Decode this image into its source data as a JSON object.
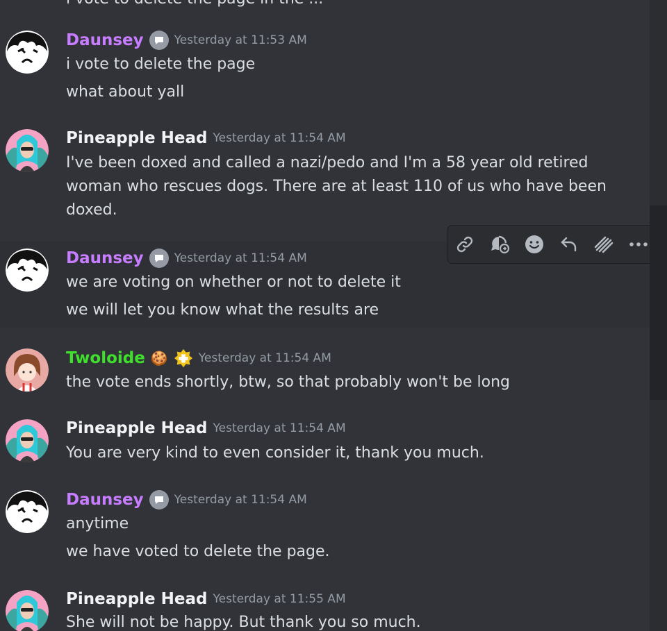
{
  "top_clipped_text": "...the page in the ... p...",
  "messages": [
    {
      "author": "Daunsey",
      "time": "Yesterday at 11:53 AM",
      "lines": [
        "i vote to delete the page",
        "what about yall"
      ]
    },
    {
      "author": "Pineapple Head",
      "time": "Yesterday at 11:54 AM",
      "lines": [
        "I've been doxed and called a nazi/pedo and I'm a 58 year old retired",
        "woman who rescues dogs. There are at least 110 of us who have been",
        "doxed."
      ]
    },
    {
      "author": "Daunsey",
      "time": "Yesterday at 11:54 AM",
      "lines": [
        "we are voting on whether or not to delete it",
        "we will let you know what the results are"
      ]
    },
    {
      "author": "Twoloide",
      "emoji": "🍪",
      "time": "Yesterday at 11:54 AM",
      "lines": [
        "the vote ends shortly, btw, so that probably won't be long"
      ]
    },
    {
      "author": "Pineapple Head",
      "time": "Yesterday at 11:54 AM",
      "lines": [
        "You are very kind to even consider it, thank you much."
      ]
    },
    {
      "author": "Daunsey",
      "time": "Yesterday at 11:54 AM",
      "lines": [
        "anytime",
        "we have voted to delete the page."
      ]
    },
    {
      "author": "Pineapple Head",
      "time": "Yesterday at 11:55 AM",
      "lines": [
        "She will not be happy.  But thank you so much."
      ]
    }
  ],
  "toolbar": {
    "icons": [
      "link-icon",
      "thread-icon",
      "emoji-icon",
      "reply-icon",
      "mark-icon",
      "more-icon"
    ]
  },
  "colors": {
    "background": "#313338",
    "daunsey_name": "#c77dff",
    "twoloide_name": "#3ee02b",
    "timestamp": "#949ba4",
    "text": "#dbdee1"
  }
}
